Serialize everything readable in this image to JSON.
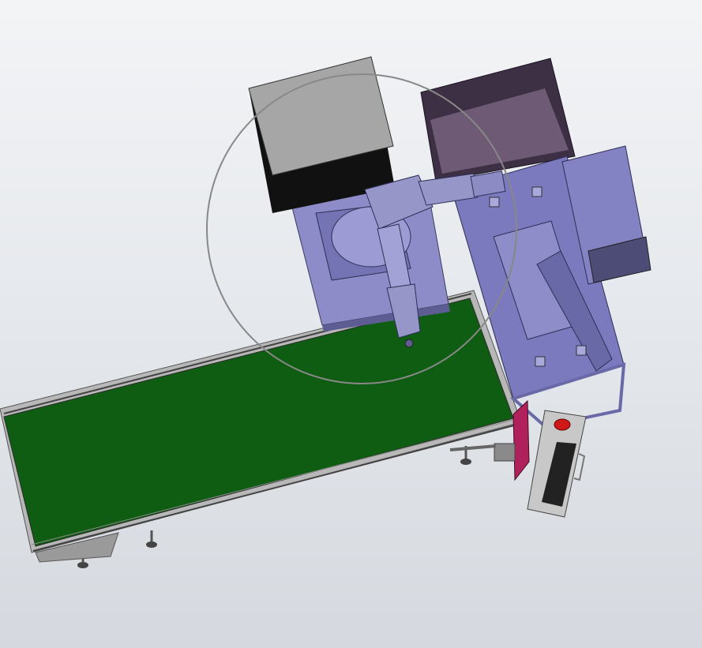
{
  "viewport": {
    "background_top": "#f3f4f6",
    "background_bottom": "#d5d9df"
  },
  "scene": {
    "objects": [
      {
        "name": "storage-box",
        "color": "#a6a6a6",
        "dark_color": "#111111"
      },
      {
        "name": "output-bin",
        "color": "#6f5a75",
        "rim_color": "#3d2f44"
      },
      {
        "name": "robot-base",
        "color": "#8d8cc8"
      },
      {
        "name": "robot-arm",
        "color": "#9796c9"
      },
      {
        "name": "work-table",
        "color": "#7b7abe"
      },
      {
        "name": "control-cabinet",
        "color": "#8382c2"
      },
      {
        "name": "conveyor-belt",
        "color": "#0f5d12",
        "frame_color": "#b8b8b8"
      },
      {
        "name": "monitor",
        "color": "#b0205a"
      },
      {
        "name": "keyboard-panel",
        "color": "#c8c8c8",
        "key_color": "#222222"
      },
      {
        "name": "emergency-stop",
        "color": "#d01818"
      },
      {
        "name": "reach-circle",
        "color": "#888888"
      }
    ]
  }
}
